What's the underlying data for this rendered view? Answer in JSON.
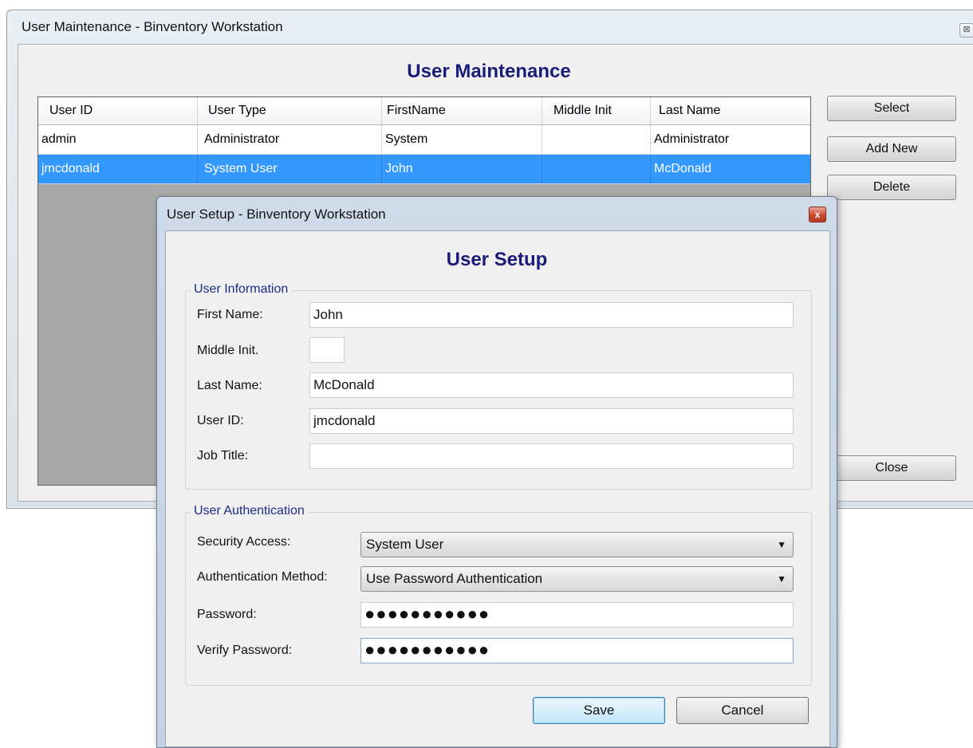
{
  "maintenance": {
    "window_title": "User Maintenance - Binventory Workstation",
    "close_glyph": "⊠",
    "heading": "User Maintenance",
    "columns": [
      "User ID",
      "User Type",
      "FirstName",
      "Middle Init",
      "Last Name"
    ],
    "rows": [
      {
        "user_id": "admin",
        "user_type": "Administrator",
        "first_name": "System",
        "middle_init": "",
        "last_name": "Administrator"
      },
      {
        "user_id": "jmcdonald",
        "user_type": "System User",
        "first_name": "John",
        "middle_init": "",
        "last_name": "McDonald"
      }
    ],
    "selected_row": 1,
    "buttons": {
      "select": "Select",
      "add_new": "Add New",
      "delete": "Delete",
      "close": "Close"
    }
  },
  "setup": {
    "window_title": "User Setup - Binventory Workstation",
    "close_glyph": "x",
    "heading": "User Setup",
    "user_information": {
      "legend": "User Information",
      "first_name_label": "First Name:",
      "first_name_value": "John",
      "middle_init_label": "Middle Init.",
      "middle_init_value": "",
      "last_name_label": "Last Name:",
      "last_name_value": "McDonald",
      "user_id_label": "User ID:",
      "user_id_value": "jmcdonald",
      "job_title_label": "Job Title:",
      "job_title_value": ""
    },
    "user_authentication": {
      "legend": "User Authentication",
      "security_access_label": "Security Access:",
      "security_access_value": "System User",
      "auth_method_label": "Authentication Method:",
      "auth_method_value": "Use Password Authentication",
      "password_label": "Password:",
      "password_value": "●●●●●●●●●●●",
      "verify_password_label": "Verify Password:",
      "verify_password_value": "●●●●●●●●●●●",
      "dropdown_glyph": "▼"
    },
    "buttons": {
      "save": "Save",
      "cancel": "Cancel"
    }
  }
}
